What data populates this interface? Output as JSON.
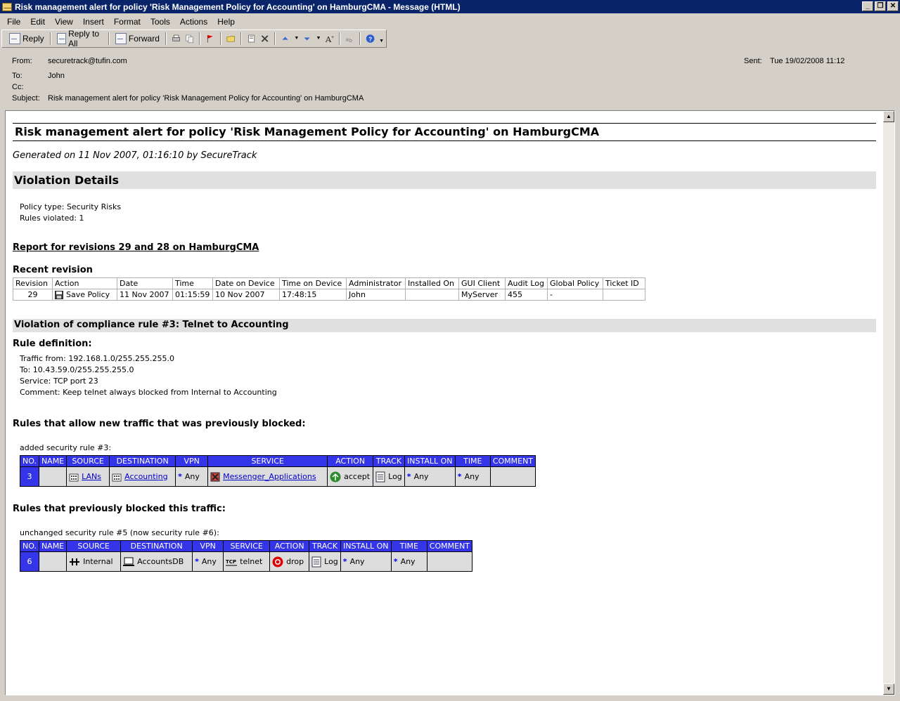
{
  "window": {
    "title": "Risk management alert for policy 'Risk Management Policy for Accounting' on HamburgCMA - Message (HTML)"
  },
  "menu": [
    "File",
    "Edit",
    "View",
    "Insert",
    "Format",
    "Tools",
    "Actions",
    "Help"
  ],
  "toolbar": {
    "reply": "Reply",
    "reply_all": "Reply to All",
    "forward": "Forward"
  },
  "header": {
    "from_label": "From:",
    "from": "securetrack@tufin.com",
    "to_label": "To:",
    "to": "John",
    "cc_label": "Cc:",
    "cc": "",
    "subject_label": "Subject:",
    "subject": "Risk management alert for policy 'Risk Management Policy for Accounting' on HamburgCMA",
    "sent_label": "Sent:",
    "sent": "Tue 19/02/2008 11:12"
  },
  "body": {
    "title": "Risk management alert for policy 'Risk Management Policy for Accounting' on HamburgCMA",
    "generated": "Generated on 11 Nov 2007, 01:16:10 by SecureTrack",
    "violation_details": "Violation Details",
    "policy_type": "Policy type: Security Risks",
    "rules_violated": "Rules violated: 1",
    "report_link": "Report for revisions 29 and 28 on HamburgCMA",
    "recent_revision": "Recent revision",
    "revision_table": {
      "headers": [
        "Revision",
        "Action",
        "Date",
        "Time",
        "Date on Device",
        "Time on Device",
        "Administrator",
        "Installed On",
        "GUI Client",
        "Audit Log",
        "Global Policy",
        "Ticket ID"
      ],
      "row": [
        "29",
        "Save Policy",
        "11 Nov 2007",
        "01:15:59",
        "10 Nov 2007",
        "17:48:15",
        "John",
        "",
        "MyServer",
        "455",
        "-",
        ""
      ]
    },
    "violation_rule": "Violation of compliance rule #3: Telnet to Accounting",
    "rule_definition": "Rule definition:",
    "traffic_from": "Traffic from: 192.168.1.0/255.255.255.0",
    "traffic_to": "To: 10.43.59.0/255.255.255.0",
    "service": "Service: TCP port 23",
    "comment": "Comment: Keep telnet always blocked from Internal to Accounting",
    "allow_heading": "Rules that allow new traffic that was previously blocked:",
    "added_rule": "added security rule #3:",
    "allow_table": {
      "headers": [
        "NO.",
        "NAME",
        "SOURCE",
        "DESTINATION",
        "VPN",
        "SERVICE",
        "ACTION",
        "TRACK",
        "INSTALL ON",
        "TIME",
        "COMMENT"
      ],
      "no": "3",
      "name": "",
      "source": "LANs",
      "destination": "Accounting",
      "vpn": "Any",
      "service": "Messenger_Applications",
      "action": "accept",
      "track": "Log",
      "install_on": "Any",
      "time": "Any",
      "comment": ""
    },
    "blocked_heading": "Rules that previously blocked this traffic:",
    "unchanged_rule": "unchanged security rule #5 (now security rule #6):",
    "blocked_table": {
      "headers": [
        "NO.",
        "NAME",
        "SOURCE",
        "DESTINATION",
        "VPN",
        "SERVICE",
        "ACTION",
        "TRACK",
        "INSTALL ON",
        "TIME",
        "COMMENT"
      ],
      "no": "6",
      "name": "",
      "source": "Internal",
      "destination": "AccountsDB",
      "vpn": "Any",
      "service": "telnet",
      "action": "drop",
      "track": "Log",
      "install_on": "Any",
      "time": "Any",
      "comment": ""
    }
  },
  "colors": {
    "titlebar": "#0a246a",
    "rule_header": "#3434e8",
    "section_bar": "#e0e0e0"
  }
}
